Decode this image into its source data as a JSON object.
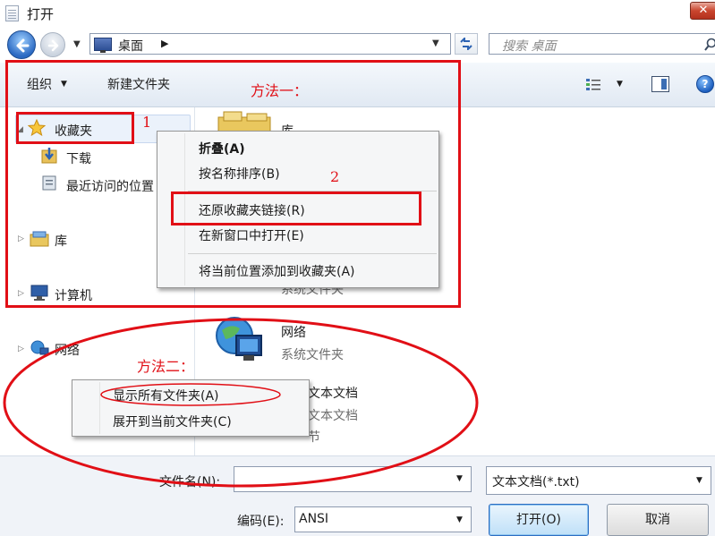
{
  "window": {
    "title": "打开",
    "close_glyph": "✕"
  },
  "nav": {
    "path": "桌面",
    "path_arrow": "▶",
    "search_placeholder": "搜索 桌面"
  },
  "toolbar": {
    "organize": "组织",
    "new_folder": "新建文件夹",
    "help": "?"
  },
  "sidebar": {
    "favorites": "收藏夹",
    "downloads": "下载",
    "recent": "最近访问的位置",
    "libraries": "库",
    "computer": "计算机",
    "network": "网络"
  },
  "content": {
    "libraries": "库",
    "system_library_type": "系统文件夹",
    "network_name": "网络",
    "network_type": "系统文件夹",
    "doc_name": "文本文档",
    "doc_type": "文本文档",
    "doc_size": "节"
  },
  "context_menu_1": {
    "collapse": "折叠(A)",
    "sort_by_name": "按名称排序(B)",
    "restore_links": "还原收藏夹链接(R)",
    "open_new_window": "在新窗口中打开(E)",
    "add_current_location": "将当前位置添加到收藏夹(A)"
  },
  "context_menu_2": {
    "show_all_folders": "显示所有文件夹(A)",
    "expand_to_current": "展开到当前文件夹(C)"
  },
  "bottom": {
    "filename_label": "文件名(N):",
    "filename_value": "",
    "filetype_value": "文本文档(*.txt)",
    "encoding_label": "编码(E):",
    "encoding_value": "ANSI",
    "open_button": "打开(O)",
    "cancel_button": "取消"
  },
  "annotations": {
    "method_one": "方法一：",
    "method_two": "方法二：",
    "step_one": "1",
    "step_two": "2"
  },
  "colors": {
    "annotation_red": "#e10f16",
    "toolbar_bg": "#e1e9f3",
    "accent_blue": "#2b69c2"
  }
}
